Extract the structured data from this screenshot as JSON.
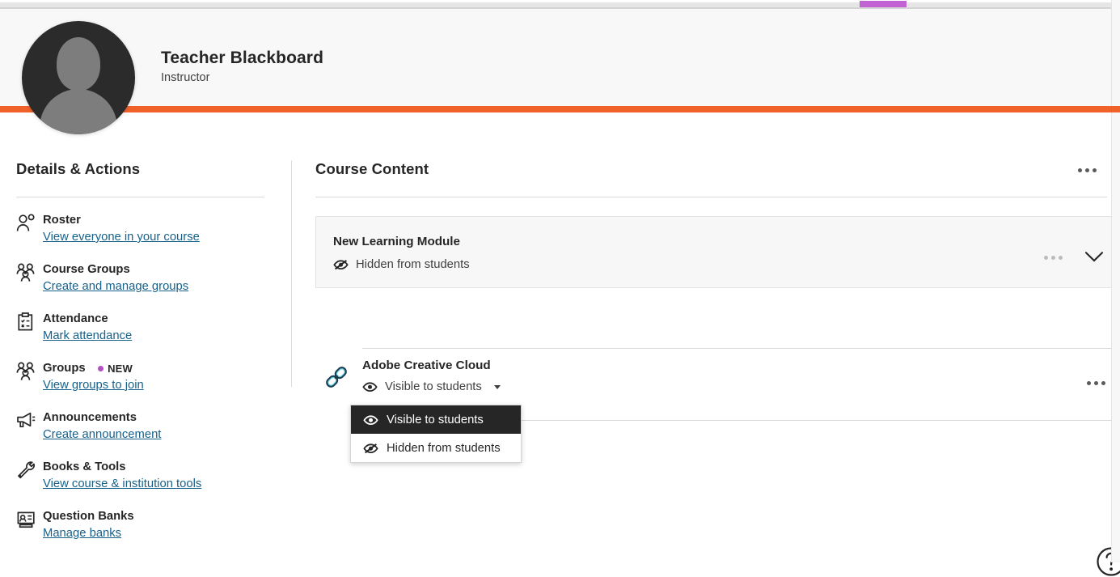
{
  "top_bar": {
    "active_tab_accent": "#c163d3"
  },
  "profile": {
    "name": "Teacher Blackboard",
    "role": "Instructor",
    "avatar_icon": "person-avatar",
    "accent_bar_color": "#f0622a"
  },
  "sidebar": {
    "title": "Details & Actions",
    "items": [
      {
        "icon": "roster-people-icon",
        "label": "Roster",
        "link": "View everyone in your course"
      },
      {
        "icon": "course-groups-icon",
        "label": "Course Groups",
        "link": "Create and manage groups"
      },
      {
        "icon": "attendance-clipboard-icon",
        "label": "Attendance",
        "link": "Mark attendance"
      },
      {
        "icon": "groups-people-icon",
        "label": "Groups",
        "link": "View groups to join",
        "badge": "NEW",
        "badge_color": "#b54fc4"
      },
      {
        "icon": "announcements-megaphone-icon",
        "label": "Announcements",
        "link": "Create announcement"
      },
      {
        "icon": "books-tools-wrench-icon",
        "label": "Books & Tools",
        "link": "View course & institution tools"
      },
      {
        "icon": "question-banks-icon",
        "label": "Question Banks",
        "link": "Manage banks"
      }
    ]
  },
  "content": {
    "title": "Course Content",
    "overflow_menu_icon": "more-options-icon",
    "module": {
      "title": "New Learning Module",
      "visibility": "Hidden from students",
      "visibility_icon": "eye-hidden-icon",
      "overflow_menu_icon": "more-options-icon",
      "expand_icon": "chevron-down-icon"
    },
    "item": {
      "title": "Adobe Creative Cloud",
      "type_icon": "link-chain-icon",
      "visibility": "Visible to students",
      "visibility_icon": "eye-visible-icon",
      "caret_icon": "caret-down-icon",
      "overflow_menu_icon": "more-options-icon"
    },
    "visibility_dropdown": {
      "options": [
        {
          "label": "Visible to students",
          "icon": "eye-visible-icon",
          "selected": true
        },
        {
          "label": "Hidden from students",
          "icon": "eye-hidden-icon",
          "selected": false
        }
      ]
    }
  },
  "help": {
    "icon": "help-question-icon"
  }
}
